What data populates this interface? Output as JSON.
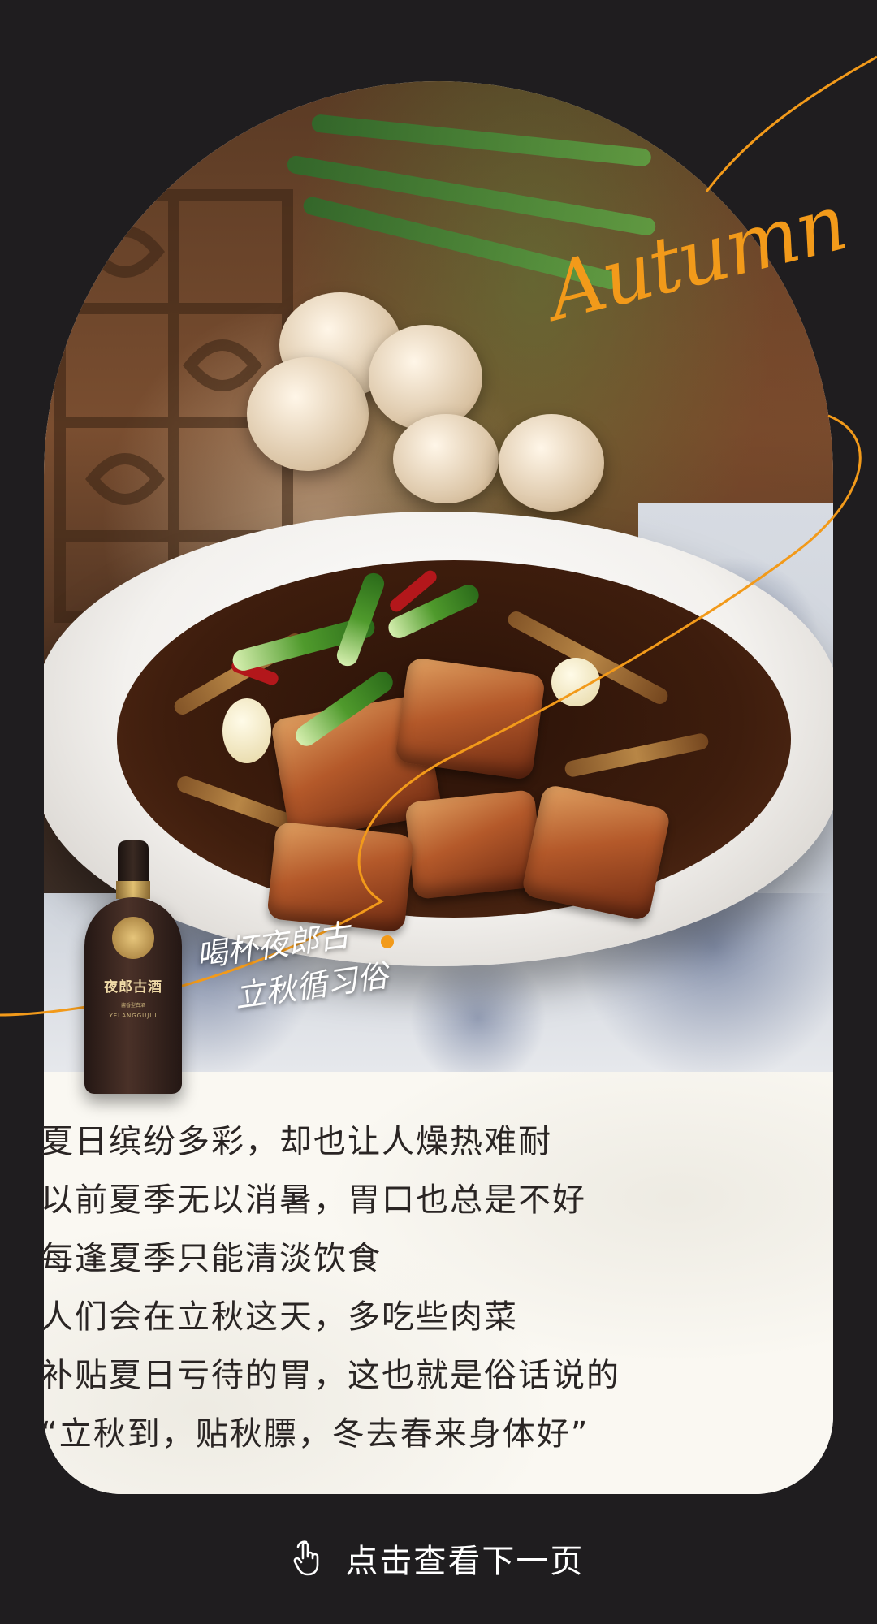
{
  "decor": {
    "script_word": "Autumn",
    "accent_color": "#f29a1a"
  },
  "bottle": {
    "brand": "夜郎古酒",
    "label_small": "酱香型白酒",
    "label_sub": "YELANGGUJIU"
  },
  "callout": {
    "line1": "喝杯夜郎古",
    "line2": "立秋循习俗"
  },
  "body_text": {
    "lines": [
      "夏日缤纷多彩，却也让人燥热难耐",
      "以前夏季无以消暑，胃口也总是不好",
      "每逢夏季只能清淡饮食",
      "人们会在立秋这天，多吃些肉菜",
      "补贴夏日亏待的胃，这也就是俗话说的",
      "“立秋到，贴秋膘，冬去春来身体好”"
    ]
  },
  "footer": {
    "icon": "tap-hand-icon",
    "label": "点击查看下一页"
  }
}
